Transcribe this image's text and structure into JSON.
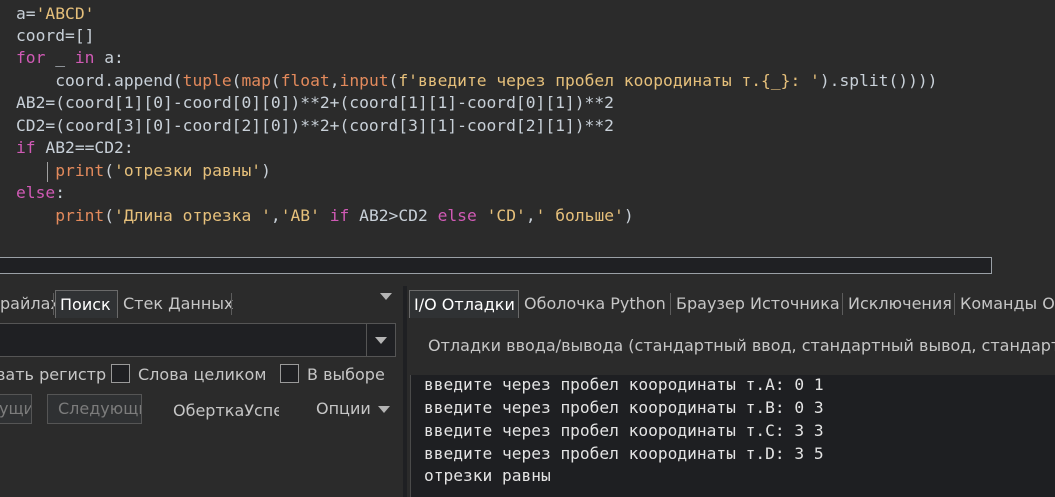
{
  "editor": {
    "lines": [
      [
        {
          "t": "a=",
          "c": "nm"
        },
        {
          "t": "'ABCD'",
          "c": "str"
        }
      ],
      [
        {
          "t": "coord=[]",
          "c": "nm"
        }
      ],
      [
        {
          "t": "for",
          "c": "kw"
        },
        {
          "t": " _ ",
          "c": "nm"
        },
        {
          "t": "in",
          "c": "kw"
        },
        {
          "t": " a:",
          "c": "nm"
        }
      ],
      [
        {
          "t": "    coord.append(",
          "c": "nm"
        },
        {
          "t": "tuple",
          "c": "fn"
        },
        {
          "t": "(",
          "c": "nm"
        },
        {
          "t": "map",
          "c": "fn"
        },
        {
          "t": "(",
          "c": "nm"
        },
        {
          "t": "float",
          "c": "fn"
        },
        {
          "t": ",",
          "c": "nm"
        },
        {
          "t": "input",
          "c": "fn"
        },
        {
          "t": "(",
          "c": "nm"
        },
        {
          "t": "f'введите через пробел коородинаты т.{_}: '",
          "c": "str"
        },
        {
          "t": ").split())))",
          "c": "nm"
        }
      ],
      [
        {
          "t": "AB2=(coord[1][0]-coord[0][0])**2+(coord[1][1]-coord[0][1])**2",
          "c": "nm"
        }
      ],
      [
        {
          "t": "CD2=(coord[3][0]-coord[2][0])**2+(coord[3][1]-coord[2][1])**2",
          "c": "nm"
        }
      ],
      [
        {
          "t": "if",
          "c": "kw"
        },
        {
          "t": " AB2==CD2:",
          "c": "nm"
        }
      ],
      [
        {
          "t": "    ",
          "c": "nm"
        },
        {
          "t": "print",
          "c": "fn"
        },
        {
          "t": "(",
          "c": "nm"
        },
        {
          "t": "'отрезки равны'",
          "c": "str"
        },
        {
          "t": ")",
          "c": "nm"
        }
      ],
      [
        {
          "t": "else",
          "c": "kw"
        },
        {
          "t": ":",
          "c": "nm"
        }
      ],
      [
        {
          "t": "    ",
          "c": "nm"
        },
        {
          "t": "print",
          "c": "fn"
        },
        {
          "t": "(",
          "c": "nm"
        },
        {
          "t": "'Длина отрезка '",
          "c": "str"
        },
        {
          "t": ",",
          "c": "nm"
        },
        {
          "t": "'AB'",
          "c": "str"
        },
        {
          "t": " ",
          "c": "nm"
        },
        {
          "t": "if",
          "c": "kw"
        },
        {
          "t": " AB2>CD2 ",
          "c": "nm"
        },
        {
          "t": "else",
          "c": "kw"
        },
        {
          "t": " ",
          "c": "nm"
        },
        {
          "t": "'CD'",
          "c": "str"
        },
        {
          "t": ",",
          "c": "nm"
        },
        {
          "t": "' больше'",
          "c": "str"
        },
        {
          "t": ")",
          "c": "nm"
        }
      ]
    ]
  },
  "left_panel": {
    "tabs": [
      "райлах",
      "Поиск",
      "Стек Данных"
    ],
    "active_tab": "Поиск",
    "search_value": "",
    "options": {
      "case_label": "вать регистр",
      "whole_words_label": "Слова целиком",
      "in_selection_label": "В выборе"
    },
    "buttons": {
      "prev_label": "ущи",
      "next_label": "Следующи",
      "wrap_label": "ОберткаУспе",
      "options_label": "Опции"
    }
  },
  "right_panel": {
    "tabs": [
      "I/O Отладки",
      "Оболочка Python",
      "Браузер Источника",
      "Исключения",
      "Команды О"
    ],
    "active_tab": "I/O Отладки",
    "description": "Отладки ввода/вывода (стандартный ввод, стандартный вывод, стандартны",
    "output_lines": [
      "введите через пробел коородинаты т.A: 0 1",
      "введите через пробел коородинаты т.B: 0 3",
      "введите через пробел коородинаты т.C: 3 3",
      "введите через пробел коородинаты т.D: 3 5",
      "отрезки равны"
    ]
  }
}
